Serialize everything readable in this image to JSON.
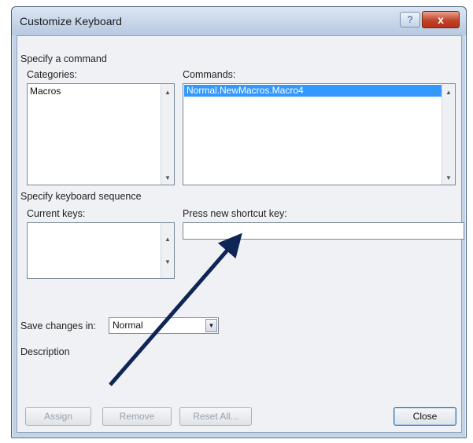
{
  "dialog": {
    "title": "Customize Keyboard",
    "help_glyph": "?",
    "close_glyph": "x"
  },
  "specify_command": {
    "group_label": "Specify a command",
    "categories_label": "Categories:",
    "categories": [
      "Macros"
    ],
    "commands_label": "Commands:",
    "commands": [
      "Normal.NewMacros.Macro4"
    ],
    "selected_command": "Normal.NewMacros.Macro4"
  },
  "keyboard_sequence": {
    "group_label": "Specify keyboard sequence",
    "current_keys_label": "Current keys:",
    "current_keys": [],
    "new_shortcut_label": "Press new shortcut key:",
    "new_shortcut_value": ""
  },
  "save_changes": {
    "label": "Save changes in:",
    "selected": "Normal"
  },
  "description_label": "Description",
  "buttons": {
    "assign": "Assign",
    "remove": "Remove",
    "reset_all": "Reset All...",
    "close": "Close"
  },
  "annotation": {
    "color": "#0f2556"
  }
}
